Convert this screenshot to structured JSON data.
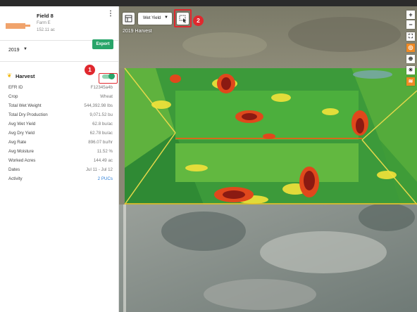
{
  "field": {
    "name": "Field 8",
    "farm": "Farm E",
    "area": "152.11 ac"
  },
  "season": {
    "year": "2019"
  },
  "export_label": "Export",
  "harvest": {
    "title": "Harvest",
    "properties": [
      {
        "label": "EFR ID",
        "value": "F12345a4b"
      },
      {
        "label": "Crop",
        "value": "Wheat"
      },
      {
        "label": "Total Wet Weight",
        "value": "544,392.98 lbs"
      },
      {
        "label": "Total Dry Production",
        "value": "9,071.52 bu"
      },
      {
        "label": "Avg Wet Yield",
        "value": "62.8 bu/ac"
      },
      {
        "label": "Avg Dry Yield",
        "value": "62.78 bu/ac"
      },
      {
        "label": "Avg Rate",
        "value": "896.07 bu/hr"
      },
      {
        "label": "Avg Moisture",
        "value": "11.52 %"
      },
      {
        "label": "Worked Acres",
        "value": "144.49 ac"
      },
      {
        "label": "Dates",
        "value": "Jul 11 - Jul 12"
      },
      {
        "label": "Activity",
        "value": "2 PUCs"
      }
    ],
    "toggle_on": true
  },
  "map": {
    "layer": "Wet Yield",
    "caption": "2019 Harvest"
  },
  "callouts": {
    "one": "1",
    "two": "2"
  },
  "colors": {
    "accent_green": "#29a56a",
    "callout_red": "#e0282e",
    "swatch_orange": "#f0a36c"
  }
}
